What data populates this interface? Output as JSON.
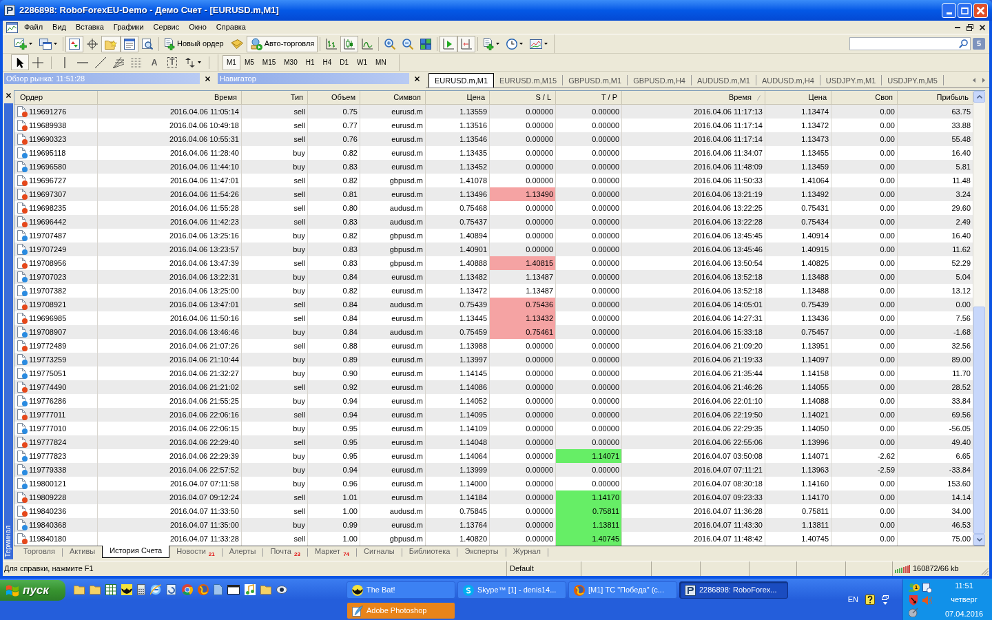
{
  "window": {
    "title": "2286898: RoboForexEU-Demo - Демо Счет - [EURUSD.m,M1]"
  },
  "menu": [
    "Файл",
    "Вид",
    "Вставка",
    "Графики",
    "Сервис",
    "Окно",
    "Справка"
  ],
  "toolbar": [
    {
      "pressed": false
    },
    {
      "pressed": false
    },
    {
      "pressed": true
    },
    {
      "pressed": false
    },
    {
      "pressed": true
    },
    {
      "pressed": true
    },
    {
      "pressed": false
    },
    {
      "label": "Новый ордер",
      "pressed": false
    },
    {
      "pressed": false
    },
    {
      "label": "Авто-торговля",
      "pressed": true
    },
    {
      "pressed": false
    },
    {
      "pressed": true
    },
    {
      "pressed": false
    },
    {
      "pressed": false
    },
    {
      "pressed": false
    },
    {
      "pressed": false
    },
    {
      "pressed": true
    },
    {
      "pressed": true
    },
    {
      "pressed": false
    },
    {
      "pressed": false
    },
    {
      "pressed": false
    }
  ],
  "messages_count": "5",
  "draw_tools": [
    {
      "pressed": true
    },
    {
      "pressed": false
    },
    {
      "pressed": false
    },
    {
      "pressed": false
    },
    {
      "pressed": false
    },
    {
      "pressed": false
    },
    {
      "pressed": false
    },
    {
      "label": "A",
      "pressed": false
    },
    {
      "label": "T",
      "pressed": false
    },
    {
      "pressed": false
    }
  ],
  "timeframes": [
    {
      "label": "M1",
      "selected": true
    },
    {
      "label": "M5",
      "selected": false
    },
    {
      "label": "M15",
      "selected": false
    },
    {
      "label": "M30",
      "selected": false
    },
    {
      "label": "H1",
      "selected": false
    },
    {
      "label": "H4",
      "selected": false
    },
    {
      "label": "D1",
      "selected": false
    },
    {
      "label": "W1",
      "selected": false
    },
    {
      "label": "MN",
      "selected": false
    }
  ],
  "market_watch": {
    "title": "Обзор рынка: 11:51:28"
  },
  "navigator": {
    "title": "Навигатор"
  },
  "chart_tabs": [
    {
      "label": "EURUSD.m,M1",
      "selected": true
    },
    {
      "label": "EURUSD.m,M15",
      "selected": false
    },
    {
      "label": "GBPUSD.m,M1",
      "selected": false
    },
    {
      "label": "GBPUSD.m,H4",
      "selected": false
    },
    {
      "label": "AUDUSD.m,M1",
      "selected": false
    },
    {
      "label": "AUDUSD.m,H4",
      "selected": false
    },
    {
      "label": "USDJPY.m,M1",
      "selected": false
    },
    {
      "label": "USDJPY.m,M5",
      "selected": false
    }
  ],
  "terminal": {
    "title": "Терминал",
    "columns": [
      {
        "label": "Ордер",
        "sorted": false
      },
      {
        "label": "Время",
        "sorted": false
      },
      {
        "label": "Тип",
        "sorted": false
      },
      {
        "label": "Объем",
        "sorted": false
      },
      {
        "label": "Символ",
        "sorted": false
      },
      {
        "label": "Цена",
        "sorted": false
      },
      {
        "label": "S / L",
        "sorted": false
      },
      {
        "label": "T / P",
        "sorted": false
      },
      {
        "label": "Время",
        "sorted": true
      },
      {
        "label": "Цена",
        "sorted": false
      },
      {
        "label": "Своп",
        "sorted": false
      },
      {
        "label": "Прибыль",
        "sorted": false
      }
    ],
    "rows": [
      {
        "cells": [
          "119691276",
          "2016.04.06 11:05:14",
          "sell",
          "0.75",
          "eurusd.m",
          "1.13559",
          "0.00000",
          "0.00000",
          "2016.04.06 11:17:13",
          "1.13474",
          "0.00",
          "63.75"
        ],
        "color": "#e5481b",
        "sl_hit": false,
        "tp_hit": false
      },
      {
        "cells": [
          "119689938",
          "2016.04.06 10:49:18",
          "sell",
          "0.77",
          "eurusd.m",
          "1.13516",
          "0.00000",
          "0.00000",
          "2016.04.06 11:17:14",
          "1.13472",
          "0.00",
          "33.88"
        ],
        "color": "#e5481b",
        "sl_hit": false,
        "tp_hit": false
      },
      {
        "cells": [
          "119690323",
          "2016.04.06 10:55:31",
          "sell",
          "0.76",
          "eurusd.m",
          "1.13546",
          "0.00000",
          "0.00000",
          "2016.04.06 11:17:14",
          "1.13473",
          "0.00",
          "55.48"
        ],
        "color": "#e5481b",
        "sl_hit": false,
        "tp_hit": false
      },
      {
        "cells": [
          "119695118",
          "2016.04.06 11:28:40",
          "buy",
          "0.82",
          "eurusd.m",
          "1.13435",
          "0.00000",
          "0.00000",
          "2016.04.06 11:34:07",
          "1.13455",
          "0.00",
          "16.40"
        ],
        "color": "#2a8be0",
        "sl_hit": false,
        "tp_hit": false
      },
      {
        "cells": [
          "119696580",
          "2016.04.06 11:44:10",
          "buy",
          "0.83",
          "eurusd.m",
          "1.13452",
          "0.00000",
          "0.00000",
          "2016.04.06 11:48:09",
          "1.13459",
          "0.00",
          "5.81"
        ],
        "color": "#2a8be0",
        "sl_hit": false,
        "tp_hit": false
      },
      {
        "cells": [
          "119696727",
          "2016.04.06 11:47:01",
          "sell",
          "0.82",
          "gbpusd.m",
          "1.41078",
          "0.00000",
          "0.00000",
          "2016.04.06 11:50:33",
          "1.41064",
          "0.00",
          "11.48"
        ],
        "color": "#e5481b",
        "sl_hit": false,
        "tp_hit": false
      },
      {
        "cells": [
          "119697307",
          "2016.04.06 11:54:26",
          "sell",
          "0.81",
          "eurusd.m",
          "1.13496",
          "1.13490",
          "0.00000",
          "2016.04.06 13:21:19",
          "1.13492",
          "0.00",
          "3.24"
        ],
        "color": "#e5481b",
        "sl_hit": true,
        "tp_hit": false
      },
      {
        "cells": [
          "119698235",
          "2016.04.06 11:55:28",
          "sell",
          "0.80",
          "audusd.m",
          "0.75468",
          "0.00000",
          "0.00000",
          "2016.04.06 13:22:25",
          "0.75431",
          "0.00",
          "29.60"
        ],
        "color": "#e5481b",
        "sl_hit": false,
        "tp_hit": false
      },
      {
        "cells": [
          "119696442",
          "2016.04.06 11:42:23",
          "sell",
          "0.83",
          "audusd.m",
          "0.75437",
          "0.00000",
          "0.00000",
          "2016.04.06 13:22:28",
          "0.75434",
          "0.00",
          "2.49"
        ],
        "color": "#e5481b",
        "sl_hit": false,
        "tp_hit": false
      },
      {
        "cells": [
          "119707487",
          "2016.04.06 13:25:16",
          "buy",
          "0.82",
          "gbpusd.m",
          "1.40894",
          "0.00000",
          "0.00000",
          "2016.04.06 13:45:45",
          "1.40914",
          "0.00",
          "16.40"
        ],
        "color": "#2a8be0",
        "sl_hit": false,
        "tp_hit": false
      },
      {
        "cells": [
          "119707249",
          "2016.04.06 13:23:57",
          "buy",
          "0.83",
          "gbpusd.m",
          "1.40901",
          "0.00000",
          "0.00000",
          "2016.04.06 13:45:46",
          "1.40915",
          "0.00",
          "11.62"
        ],
        "color": "#2a8be0",
        "sl_hit": false,
        "tp_hit": false
      },
      {
        "cells": [
          "119708956",
          "2016.04.06 13:47:39",
          "sell",
          "0.83",
          "gbpusd.m",
          "1.40888",
          "1.40815",
          "0.00000",
          "2016.04.06 13:50:54",
          "1.40825",
          "0.00",
          "52.29"
        ],
        "color": "#e5481b",
        "sl_hit": true,
        "tp_hit": false
      },
      {
        "cells": [
          "119707023",
          "2016.04.06 13:22:31",
          "buy",
          "0.84",
          "eurusd.m",
          "1.13482",
          "1.13487",
          "0.00000",
          "2016.04.06 13:52:18",
          "1.13488",
          "0.00",
          "5.04"
        ],
        "color": "#2a8be0",
        "sl_hit": false,
        "tp_hit": false
      },
      {
        "cells": [
          "119707382",
          "2016.04.06 13:25:00",
          "buy",
          "0.82",
          "eurusd.m",
          "1.13472",
          "1.13487",
          "0.00000",
          "2016.04.06 13:52:18",
          "1.13488",
          "0.00",
          "13.12"
        ],
        "color": "#2a8be0",
        "sl_hit": false,
        "tp_hit": false
      },
      {
        "cells": [
          "119708921",
          "2016.04.06 13:47:01",
          "sell",
          "0.84",
          "audusd.m",
          "0.75439",
          "0.75436",
          "0.00000",
          "2016.04.06 14:05:01",
          "0.75439",
          "0.00",
          "0.00"
        ],
        "color": "#e5481b",
        "sl_hit": true,
        "tp_hit": false
      },
      {
        "cells": [
          "119696985",
          "2016.04.06 11:50:16",
          "sell",
          "0.84",
          "eurusd.m",
          "1.13445",
          "1.13432",
          "0.00000",
          "2016.04.06 14:27:31",
          "1.13436",
          "0.00",
          "7.56"
        ],
        "color": "#e5481b",
        "sl_hit": true,
        "tp_hit": false
      },
      {
        "cells": [
          "119708907",
          "2016.04.06 13:46:46",
          "buy",
          "0.84",
          "audusd.m",
          "0.75459",
          "0.75461",
          "0.00000",
          "2016.04.06 15:33:18",
          "0.75457",
          "0.00",
          "-1.68"
        ],
        "color": "#2a8be0",
        "sl_hit": true,
        "tp_hit": false
      },
      {
        "cells": [
          "119772489",
          "2016.04.06 21:07:26",
          "sell",
          "0.88",
          "eurusd.m",
          "1.13988",
          "0.00000",
          "0.00000",
          "2016.04.06 21:09:20",
          "1.13951",
          "0.00",
          "32.56"
        ],
        "color": "#e5481b",
        "sl_hit": false,
        "tp_hit": false
      },
      {
        "cells": [
          "119773259",
          "2016.04.06 21:10:44",
          "buy",
          "0.89",
          "eurusd.m",
          "1.13997",
          "0.00000",
          "0.00000",
          "2016.04.06 21:19:33",
          "1.14097",
          "0.00",
          "89.00"
        ],
        "color": "#2a8be0",
        "sl_hit": false,
        "tp_hit": false
      },
      {
        "cells": [
          "119775051",
          "2016.04.06 21:32:27",
          "buy",
          "0.90",
          "eurusd.m",
          "1.14145",
          "0.00000",
          "0.00000",
          "2016.04.06 21:35:44",
          "1.14158",
          "0.00",
          "11.70"
        ],
        "color": "#2a8be0",
        "sl_hit": false,
        "tp_hit": false
      },
      {
        "cells": [
          "119774490",
          "2016.04.06 21:21:02",
          "sell",
          "0.92",
          "eurusd.m",
          "1.14086",
          "0.00000",
          "0.00000",
          "2016.04.06 21:46:26",
          "1.14055",
          "0.00",
          "28.52"
        ],
        "color": "#e5481b",
        "sl_hit": false,
        "tp_hit": false
      },
      {
        "cells": [
          "119776286",
          "2016.04.06 21:55:25",
          "buy",
          "0.94",
          "eurusd.m",
          "1.14052",
          "0.00000",
          "0.00000",
          "2016.04.06 22:01:10",
          "1.14088",
          "0.00",
          "33.84"
        ],
        "color": "#2a8be0",
        "sl_hit": false,
        "tp_hit": false
      },
      {
        "cells": [
          "119777011",
          "2016.04.06 22:06:16",
          "sell",
          "0.94",
          "eurusd.m",
          "1.14095",
          "0.00000",
          "0.00000",
          "2016.04.06 22:19:50",
          "1.14021",
          "0.00",
          "69.56"
        ],
        "color": "#e5481b",
        "sl_hit": false,
        "tp_hit": false
      },
      {
        "cells": [
          "119777010",
          "2016.04.06 22:06:15",
          "buy",
          "0.95",
          "eurusd.m",
          "1.14109",
          "0.00000",
          "0.00000",
          "2016.04.06 22:29:35",
          "1.14050",
          "0.00",
          "-56.05"
        ],
        "color": "#2a8be0",
        "sl_hit": false,
        "tp_hit": false
      },
      {
        "cells": [
          "119777824",
          "2016.04.06 22:29:40",
          "sell",
          "0.95",
          "eurusd.m",
          "1.14048",
          "0.00000",
          "0.00000",
          "2016.04.06 22:55:06",
          "1.13996",
          "0.00",
          "49.40"
        ],
        "color": "#e5481b",
        "sl_hit": false,
        "tp_hit": false
      },
      {
        "cells": [
          "119777823",
          "2016.04.06 22:29:39",
          "buy",
          "0.95",
          "eurusd.m",
          "1.14064",
          "0.00000",
          "1.14071",
          "2016.04.07 03:50:08",
          "1.14071",
          "-2.62",
          "6.65"
        ],
        "color": "#2a8be0",
        "sl_hit": false,
        "tp_hit": true
      },
      {
        "cells": [
          "119779338",
          "2016.04.06 22:57:52",
          "buy",
          "0.94",
          "eurusd.m",
          "1.13999",
          "0.00000",
          "0.00000",
          "2016.04.07 07:11:21",
          "1.13963",
          "-2.59",
          "-33.84"
        ],
        "color": "#2a8be0",
        "sl_hit": false,
        "tp_hit": false
      },
      {
        "cells": [
          "119800121",
          "2016.04.07 07:11:58",
          "buy",
          "0.96",
          "eurusd.m",
          "1.14000",
          "0.00000",
          "0.00000",
          "2016.04.07 08:30:18",
          "1.14160",
          "0.00",
          "153.60"
        ],
        "color": "#2a8be0",
        "sl_hit": false,
        "tp_hit": false
      },
      {
        "cells": [
          "119809228",
          "2016.04.07 09:12:24",
          "sell",
          "1.01",
          "eurusd.m",
          "1.14184",
          "0.00000",
          "1.14170",
          "2016.04.07 09:23:33",
          "1.14170",
          "0.00",
          "14.14"
        ],
        "color": "#e5481b",
        "sl_hit": false,
        "tp_hit": true
      },
      {
        "cells": [
          "119840236",
          "2016.04.07 11:33:50",
          "sell",
          "1.00",
          "audusd.m",
          "0.75845",
          "0.00000",
          "0.75811",
          "2016.04.07 11:36:28",
          "0.75811",
          "0.00",
          "34.00"
        ],
        "color": "#e5481b",
        "sl_hit": false,
        "tp_hit": true
      },
      {
        "cells": [
          "119840368",
          "2016.04.07 11:35:00",
          "buy",
          "0.99",
          "eurusd.m",
          "1.13764",
          "0.00000",
          "1.13811",
          "2016.04.07 11:43:30",
          "1.13811",
          "0.00",
          "46.53"
        ],
        "color": "#2a8be0",
        "sl_hit": false,
        "tp_hit": true
      },
      {
        "cells": [
          "119840180",
          "2016.04.07 11:33:28",
          "sell",
          "1.00",
          "gbpusd.m",
          "1.40820",
          "0.00000",
          "1.40745",
          "2016.04.07 11:48:42",
          "1.40745",
          "0.00",
          "75.00"
        ],
        "color": "#e5481b",
        "sl_hit": false,
        "tp_hit": true
      }
    ],
    "tabs": [
      {
        "label": "Торговля",
        "selected": false
      },
      {
        "label": "Активы",
        "selected": false
      },
      {
        "label": "История Счета",
        "selected": true
      },
      {
        "label": "Новости",
        "badge": "21",
        "selected": false
      },
      {
        "label": "Алерты",
        "selected": false
      },
      {
        "label": "Почта",
        "badge": "23",
        "selected": false
      },
      {
        "label": "Маркет",
        "badge": "74",
        "selected": false
      },
      {
        "label": "Сигналы",
        "selected": false
      },
      {
        "label": "Библиотека",
        "selected": false
      },
      {
        "label": "Эксперты",
        "selected": false
      },
      {
        "label": "Журнал",
        "selected": false
      }
    ]
  },
  "status_bar": {
    "help": "Для справки, нажмите F1",
    "profile": "Default",
    "traffic": "160872/66 kb"
  },
  "taskbar": {
    "start": "пуск",
    "tasks": [
      {
        "label": "The Bat!",
        "active": false,
        "attention": false
      },
      {
        "label": "Skype™ [1] - denis14...",
        "active": false,
        "attention": false
      },
      {
        "label": "[M1] ТС \"Победа\" (с...",
        "active": false,
        "attention": false
      },
      {
        "label": "2286898: RoboForex...",
        "active": true,
        "attention": false
      },
      {
        "label": "Adobe Photoshop",
        "active": false,
        "attention": true
      }
    ],
    "language": "EN",
    "tray_badge": "1",
    "clock": {
      "time": "11:51",
      "day": "четверг",
      "date": "07.04.2016"
    }
  }
}
